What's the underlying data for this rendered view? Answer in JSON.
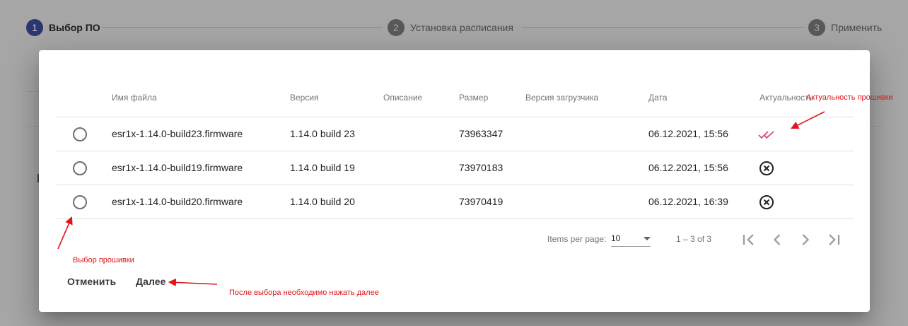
{
  "stepper": {
    "steps": [
      {
        "num": "1",
        "label": "Выбор ПО"
      },
      {
        "num": "2",
        "label": "Установка расписания"
      },
      {
        "num": "3",
        "label": "Применить"
      }
    ]
  },
  "table": {
    "headers": {
      "filename": "Имя файла",
      "version": "Версия",
      "description": "Описание",
      "size": "Размер",
      "bootloader": "Версия загрузчика",
      "date": "Дата",
      "actuality": "Актуальность"
    },
    "rows": [
      {
        "filename": "esr1x-1.14.0-build23.firmware",
        "version": "1.14.0 build 23",
        "description": "",
        "size": "73963347",
        "bootloader": "",
        "date": "06.12.2021, 15:56",
        "status_icon": "double-check-icon",
        "status_color": "#e0457b"
      },
      {
        "filename": "esr1x-1.14.0-build19.firmware",
        "version": "1.14.0 build 19",
        "description": "",
        "size": "73970183",
        "bootloader": "",
        "date": "06.12.2021, 15:56",
        "status_icon": "cancel-circle-icon",
        "status_color": "#212121"
      },
      {
        "filename": "esr1x-1.14.0-build20.firmware",
        "version": "1.14.0 build 20",
        "description": "",
        "size": "73970419",
        "bootloader": "",
        "date": "06.12.2021, 16:39",
        "status_icon": "cancel-circle-icon",
        "status_color": "#212121"
      }
    ]
  },
  "paginator": {
    "items_per_page_label": "Items per page:",
    "page_size": "10",
    "range_label": "1 – 3 of 3"
  },
  "actions": {
    "cancel_label": "Отменить",
    "next_label": "Далее"
  },
  "annotations": {
    "actuality": "Актуальность прошивки",
    "select": "Выбор прошивки",
    "after_select": "После выбора необходимо нажать далее",
    "color": "#e0141b"
  }
}
